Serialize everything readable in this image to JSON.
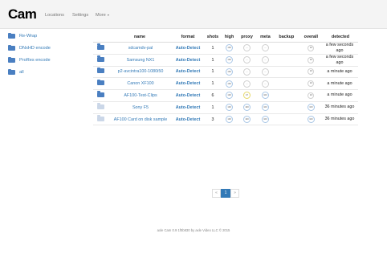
{
  "app": {
    "brand": "Cam"
  },
  "nav": {
    "locations": "Locations",
    "settings": "Settings",
    "more": "More"
  },
  "sidebar": {
    "items": [
      {
        "label": "Re-Wrap"
      },
      {
        "label": "DNxHD encode"
      },
      {
        "label": "ProRes encode"
      },
      {
        "label": "all"
      }
    ]
  },
  "table": {
    "headers": {
      "name": "name",
      "format": "format",
      "shots": "shots",
      "high": "high",
      "proxy": "proxy",
      "meta": "meta",
      "backup": "backup",
      "overall": "overall",
      "detected": "detected"
    },
    "rows": [
      {
        "name": "xdcamdv-pal",
        "format": "Auto-Detect",
        "shots": "1",
        "high": "100",
        "proxy": "—",
        "meta": "—",
        "overall": "16",
        "detected": "a few seconds ago",
        "dim": false
      },
      {
        "name": "Samsung NX1",
        "format": "Auto-Detect",
        "shots": "1",
        "high": "100",
        "proxy": "—",
        "meta": "—",
        "overall": "16",
        "detected": "a few seconds ago",
        "dim": false
      },
      {
        "name": "p2-avcintra100-1080i50",
        "format": "Auto-Detect",
        "shots": "1",
        "high": "100",
        "proxy": "—",
        "meta": "—",
        "overall": "16",
        "detected": "a minute ago",
        "dim": false
      },
      {
        "name": "Canon XF100",
        "format": "Auto-Detect",
        "shots": "1",
        "high": "100",
        "proxy": "—",
        "meta": "—",
        "overall": "16",
        "detected": "a minute ago",
        "dim": false
      },
      {
        "name": "AF100-Test-Clips",
        "format": "Auto-Detect",
        "shots": "6",
        "high": "100",
        "proxy": "47",
        "meta": "100",
        "overall": "16",
        "detected": "a minute ago",
        "dim": false
      },
      {
        "name": "Sony F5",
        "format": "Auto-Detect",
        "shots": "1",
        "high": "100",
        "proxy": "100",
        "meta": "100",
        "overall": "100",
        "detected": "36 minutes ago",
        "dim": true
      },
      {
        "name": "AF100 Card on disk sample",
        "format": "Auto-Detect",
        "shots": "3",
        "high": "100",
        "proxy": "100",
        "meta": "100",
        "overall": "100",
        "detected": "36 minutes ago",
        "dim": true
      }
    ]
  },
  "pagination": {
    "prev": "«",
    "current": "1",
    "next": "»"
  },
  "footer": {
    "text": "axle Cam 0.9 1f0b830 by axle Video LLC © 2015"
  },
  "colors": {
    "accent": "#337ab7",
    "folder": "#4a7fc1",
    "folder_light": "#cbd7e8"
  }
}
